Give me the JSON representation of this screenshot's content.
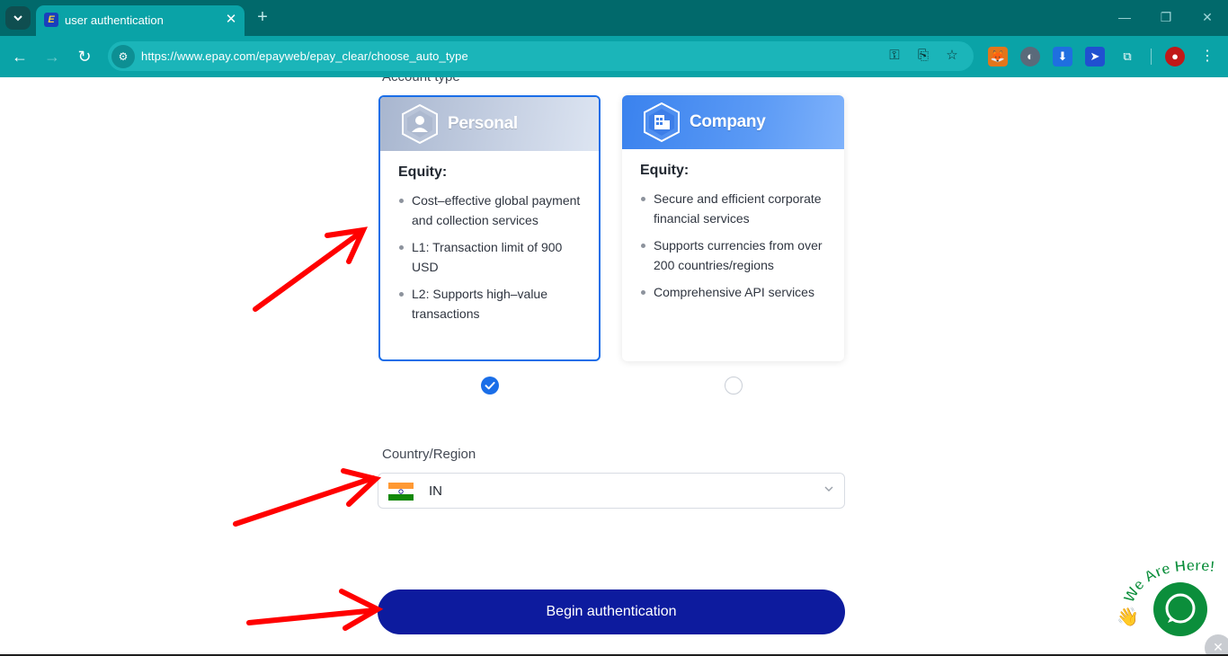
{
  "browser": {
    "tab_title": "user authentication",
    "url": "https://www.epay.com/epayweb/epay_clear/choose_auto_type",
    "tab_favicon_letter": "E"
  },
  "page": {
    "account_type_label": "Account type",
    "cards": [
      {
        "title": "Personal",
        "equity_label": "Equity:",
        "benefits": [
          "Cost–effective global payment and collection services",
          "L1: Transaction limit of 900 USD",
          "L2: Supports high–value transactions"
        ],
        "selected": true
      },
      {
        "title": "Company",
        "equity_label": "Equity:",
        "benefits": [
          "Secure and efficient corporate financial services",
          "Supports currencies from over 200 countries/regions",
          "Comprehensive API services"
        ],
        "selected": false
      }
    ],
    "country_label": "Country/Region",
    "country_value": "IN",
    "begin_button": "Begin authentication",
    "chat_badge_text": "We Are Here!"
  },
  "colors": {
    "accent": "#1a6ee8",
    "button": "#0d1b9e",
    "browser_frame": "#01696b",
    "annotation_arrow": "#ff0000",
    "chat": "#0b8e3b"
  },
  "icons": [
    "search-tabs-icon",
    "back-icon",
    "forward-icon",
    "reload-icon",
    "site-settings-icon",
    "password-key-icon",
    "install-app-icon",
    "bookmark-star-icon",
    "metamask-icon",
    "extension-icon",
    "download-icon",
    "puzzle-icon",
    "profile-icon",
    "menu-icon"
  ]
}
